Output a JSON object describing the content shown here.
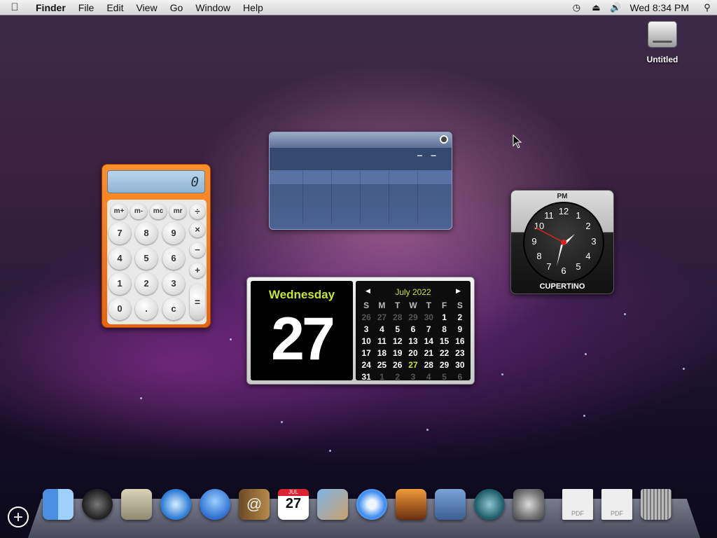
{
  "menubar": {
    "app": "Finder",
    "menus": [
      "File",
      "Edit",
      "View",
      "Go",
      "Window",
      "Help"
    ],
    "clock": "Wed 8:34 PM"
  },
  "desktop": {
    "disk_label": "Untitled"
  },
  "calculator": {
    "display": "0",
    "mem_keys": [
      "m+",
      "m-",
      "mc",
      "mr"
    ],
    "ops": [
      "÷",
      "×",
      "−",
      "+",
      "="
    ],
    "rows": [
      [
        "7",
        "8",
        "9"
      ],
      [
        "4",
        "5",
        "6"
      ],
      [
        "1",
        "2",
        "3"
      ],
      [
        "0",
        ".",
        "c"
      ]
    ]
  },
  "blank_widget": {
    "dashes": "– –"
  },
  "world_clock": {
    "ampm": "PM",
    "city": "CUPERTINO",
    "numbers": [
      "12",
      "1",
      "2",
      "3",
      "4",
      "5",
      "6",
      "7",
      "8",
      "9",
      "10",
      "11"
    ]
  },
  "ical": {
    "day_name": "Wednesday",
    "day_number": "27",
    "month_title": "July 2022",
    "weekday_headers": [
      "S",
      "M",
      "T",
      "W",
      "T",
      "F",
      "S"
    ],
    "weeks": [
      [
        "26",
        "27",
        "28",
        "29",
        "30",
        "1",
        "2"
      ],
      [
        "3",
        "4",
        "5",
        "6",
        "7",
        "8",
        "9"
      ],
      [
        "10",
        "11",
        "12",
        "13",
        "14",
        "15",
        "16"
      ],
      [
        "17",
        "18",
        "19",
        "20",
        "21",
        "22",
        "23"
      ],
      [
        "24",
        "25",
        "26",
        "27",
        "28",
        "29",
        "30"
      ],
      [
        "31",
        "1",
        "2",
        "3",
        "4",
        "5",
        "6"
      ]
    ]
  },
  "dock": {
    "items": [
      "Finder",
      "Dashboard",
      "Mail",
      "Safari",
      "iChat",
      "Address Book",
      "iCal",
      "iPhoto",
      "iTunes",
      "Photo Booth",
      "Spaces",
      "Time Machine",
      "System Preferences",
      "PDF",
      "PDF",
      "Trash"
    ],
    "cal_badge_month": "JUL",
    "cal_badge_day": "27",
    "pdf_label": "PDF"
  },
  "colors": {
    "accent_green": "#c8e62c",
    "calc_orange": "#f27a1a"
  }
}
